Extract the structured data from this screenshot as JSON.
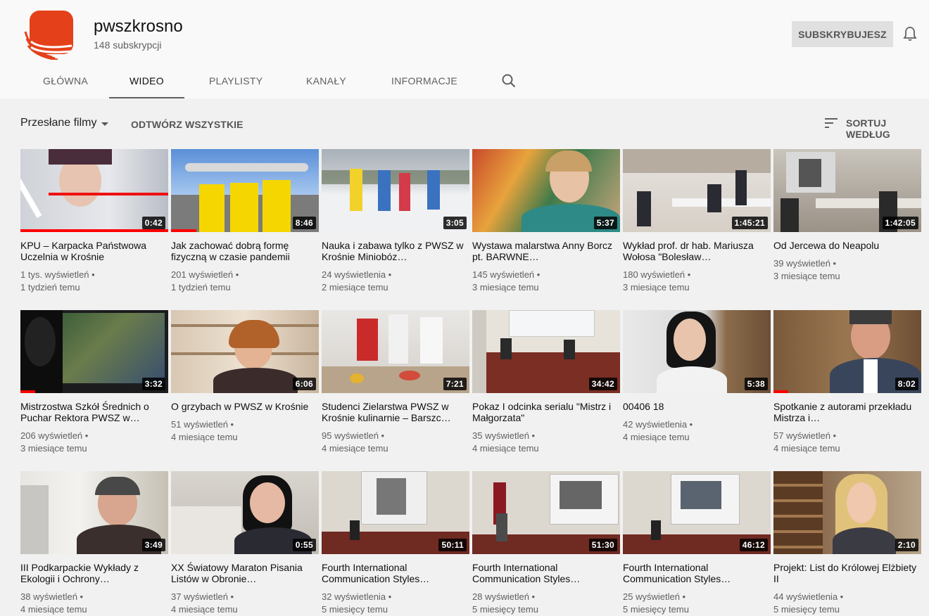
{
  "channel": {
    "name": "pwszkrosno",
    "subscribers": "148 subskrypcji",
    "subscribe_label": "SUBSKRYBUJESZ"
  },
  "tabs": [
    {
      "label": "GŁÓWNA"
    },
    {
      "label": "WIDEO",
      "active": true
    },
    {
      "label": "PLAYLISTY"
    },
    {
      "label": "KANAŁY"
    },
    {
      "label": "INFORMACJE"
    }
  ],
  "filter": {
    "uploads_label": "Przesłane filmy",
    "play_all_label": "ODTWÓRZ WSZYSTKIE",
    "sort_label": "SORTUJ WEDŁUG"
  },
  "icons": {
    "logo": "pwsz-logo-icon",
    "bell": "bell-icon",
    "search": "search-icon",
    "dropdown": "caret-down-icon",
    "sort": "sort-icon"
  },
  "colors": {
    "logo_orange": "#e4411a",
    "progress_red": "#ff0000",
    "subscribed_bg": "#e0e0e0"
  },
  "videos": [
    {
      "title": "KPU – Karpacka Państwowa Uczelnia w Krośnie",
      "duration": "0:42",
      "views": "1 tys. wyświetleń •",
      "age": "1 tydzień temu",
      "progress": 1.0
    },
    {
      "title": "Jak zachować dobrą formę fizyczną w czasie pandemii",
      "duration": "8:46",
      "views": "201 wyświetleń •",
      "age": "1 tydzień temu",
      "progress": 0.17
    },
    {
      "title": "Nauka i zabawa tylko z PWSZ w Krośnie Miniobóz…",
      "duration": "3:05",
      "views": "24 wyświetlenia •",
      "age": "2 miesiące temu",
      "progress": 0
    },
    {
      "title": "Wystawa malarstwa Anny Borcz pt. BARWNE…",
      "duration": "5:37",
      "views": "145 wyświetleń •",
      "age": "3 miesiące temu",
      "progress": 0
    },
    {
      "title": "Wykład prof. dr hab. Mariusza Wołosa \"Bolesław…",
      "duration": "1:45:21",
      "views": "180 wyświetleń •",
      "age": "3 miesiące temu",
      "progress": 0
    },
    {
      "title": "Od Jercewa do Neapolu",
      "duration": "1:42:05",
      "views": "39 wyświetleń •",
      "age": "3 miesiące temu",
      "progress": 0
    },
    {
      "title": "Mistrzostwa Szkół Średnich o Puchar Rektora PWSZ w…",
      "duration": "3:32",
      "views": "206 wyświetleń •",
      "age": "3 miesiące temu",
      "progress": 0.1
    },
    {
      "title": "O grzybach w PWSZ w Krośnie",
      "duration": "6:06",
      "views": "51 wyświetleń •",
      "age": "4 miesiące temu",
      "progress": 0
    },
    {
      "title": "Studenci Zielarstwa PWSZ w Krośnie kulinarnie – Barszc…",
      "duration": "7:21",
      "views": "95 wyświetleń •",
      "age": "4 miesiące temu",
      "progress": 0
    },
    {
      "title": "Pokaz I odcinka serialu \"Mistrz i Małgorzata\"",
      "duration": "34:42",
      "views": "35 wyświetleń •",
      "age": "4 miesiące temu",
      "progress": 0
    },
    {
      "title": "00406 18",
      "duration": "5:38",
      "views": "42 wyświetlenia •",
      "age": "4 miesiące temu",
      "progress": 0
    },
    {
      "title": "Spotkanie z autorami przekładu Mistrza i…",
      "duration": "8:02",
      "views": "57 wyświetleń •",
      "age": "4 miesiące temu",
      "progress": 0.1
    },
    {
      "title": "III Podkarpackie Wykłady z Ekologii i Ochrony…",
      "duration": "3:49",
      "views": "38 wyświetleń •",
      "age": "4 miesiące temu",
      "progress": 0
    },
    {
      "title": "XX Światowy Maraton Pisania Listów w Obronie…",
      "duration": "0:55",
      "views": "37 wyświetleń •",
      "age": "4 miesiące temu",
      "progress": 0
    },
    {
      "title": "Fourth International Communication Styles…",
      "duration": "50:11",
      "views": "32 wyświetlenia •",
      "age": "5 miesięcy temu",
      "progress": 0
    },
    {
      "title": "Fourth International Communication Styles…",
      "duration": "51:30",
      "views": "28 wyświetleń •",
      "age": "5 miesięcy temu",
      "progress": 0
    },
    {
      "title": "Fourth International Communication Styles…",
      "duration": "46:12",
      "views": "25 wyświetleń •",
      "age": "5 miesięcy temu",
      "progress": 0
    },
    {
      "title": "Projekt: List do Królowej Elżbiety II",
      "duration": "2:10",
      "views": "44 wyświetlenia •",
      "age": "5 miesięcy temu",
      "progress": 0
    }
  ]
}
